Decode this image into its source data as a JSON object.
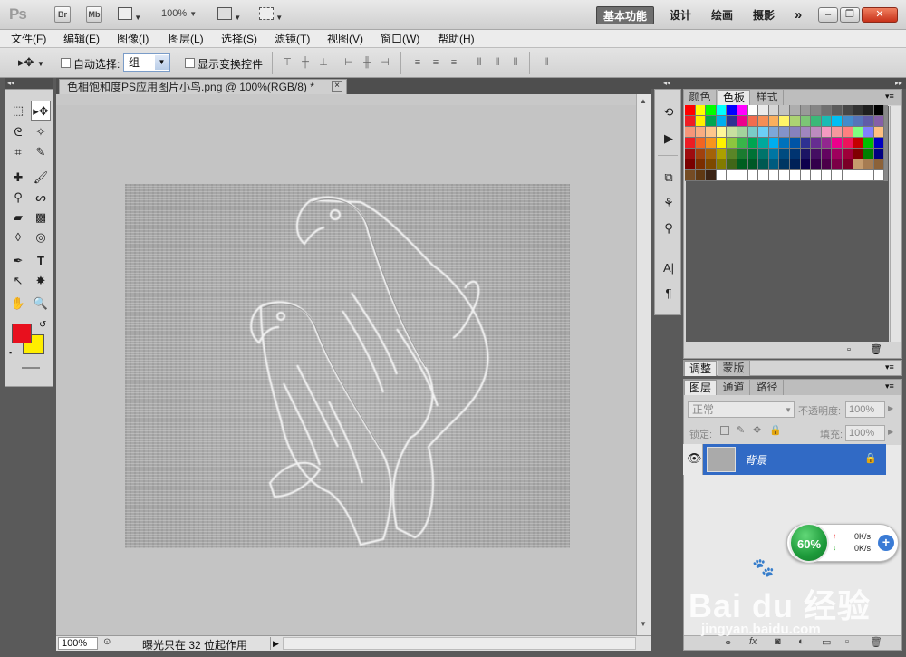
{
  "app": {
    "logo": "Ps",
    "bridge": "Br",
    "minibridge": "Mb",
    "zoom": "100%"
  },
  "workspaces": [
    "基本功能",
    "设计",
    "绘画",
    "摄影",
    "»"
  ],
  "menus": [
    "文件(F)",
    "编辑(E)",
    "图像(I)",
    "图层(L)",
    "选择(S)",
    "滤镜(T)",
    "视图(V)",
    "窗口(W)",
    "帮助(H)"
  ],
  "options": {
    "auto_select_label": "自动选择:",
    "auto_select_value": "组",
    "show_transform_label": "显示变换控件"
  },
  "document": {
    "tab_title": "色相饱和度PS应用图片小鸟.png @ 100%(RGB/8) *",
    "close": "×"
  },
  "status": {
    "zoom": "100%",
    "message": "曝光只在 32 位起作用"
  },
  "colors": {
    "foreground": "#e8101e",
    "background": "#ffee00"
  },
  "panels": {
    "color_tabs": [
      "颜色",
      "色板",
      "样式"
    ],
    "adjust_tabs": [
      "调整",
      "蒙版"
    ],
    "layer_tabs": [
      "图层",
      "通道",
      "路径"
    ],
    "blend_mode": "正常",
    "opacity_label": "不透明度:",
    "opacity_value": "100%",
    "lock_label": "锁定:",
    "fill_label": "填充:",
    "fill_value": "100%",
    "layer_name": "背景"
  },
  "swatches": [
    "#ff0000",
    "#ffff00",
    "#00ff00",
    "#00ffff",
    "#0000ff",
    "#ff00ff",
    "#ffffff",
    "#ebebeb",
    "#d6d6d6",
    "#c2c2c2",
    "#adadad",
    "#999999",
    "#858585",
    "#707070",
    "#5c5c5c",
    "#474747",
    "#333333",
    "#1f1f1f",
    "#000000",
    "#ee1d24",
    "#fff100",
    "#00a650",
    "#00aeef",
    "#2f3192",
    "#ec008c",
    "#f26c4f",
    "#f68e55",
    "#fbaf5d",
    "#fff467",
    "#acd372",
    "#7cc576",
    "#3bb878",
    "#1abbb4",
    "#00bff3",
    "#438ccb",
    "#5574b9",
    "#605ca8",
    "#855fa8",
    "#f69679",
    "#f9ad81",
    "#fdc68c",
    "#fff799",
    "#c7e09f",
    "#a3d39c",
    "#7accc8",
    "#6dcff6",
    "#7da7d9",
    "#8393ca",
    "#8781bd",
    "#a186be",
    "#bd8cbf",
    "#f49ac1",
    "#f5989d",
    "#ff8080",
    "#80ff80",
    "#8080ff",
    "#ffbf80",
    "#ed1c24",
    "#f26522",
    "#f7941d",
    "#fff200",
    "#8dc63f",
    "#39b54a",
    "#00a651",
    "#00a99d",
    "#00aeef",
    "#0072bc",
    "#0054a6",
    "#2e3192",
    "#662d91",
    "#92278f",
    "#ec008c",
    "#ed145b",
    "#c40000",
    "#00c000",
    "#0000c0",
    "#9e0b0f",
    "#a0410d",
    "#a36209",
    "#aba000",
    "#598527",
    "#1a7b30",
    "#007236",
    "#00746b",
    "#0076a3",
    "#004b80",
    "#003471",
    "#1b1464",
    "#440e62",
    "#630460",
    "#9e005d",
    "#9e0039",
    "#800000",
    "#008000",
    "#000080",
    "#790000",
    "#7b2e00",
    "#7d4900",
    "#827b00",
    "#406618",
    "#005e20",
    "#005826",
    "#005952",
    "#005b7f",
    "#003663",
    "#002157",
    "#0d004c",
    "#32004b",
    "#4b0049",
    "#7b0046",
    "#7a0026",
    "#c69c6d",
    "#a67c52",
    "#8c6239",
    "#754c24",
    "#603913",
    "#3c2415",
    "#ffffff",
    "#ffffff",
    "#ffffff",
    "#ffffff",
    "#ffffff",
    "#ffffff",
    "#ffffff",
    "#ffffff",
    "#ffffff",
    "#ffffff",
    "#ffffff",
    "#ffffff",
    "#ffffff",
    "#ffffff",
    "#ffffff",
    "#ffffff"
  ],
  "net_widget": {
    "percent": "60%",
    "up": "0K/s",
    "down": "0K/s"
  },
  "watermark": {
    "brand": "Bai du 经验",
    "url": "jingyan.baidu.com"
  }
}
